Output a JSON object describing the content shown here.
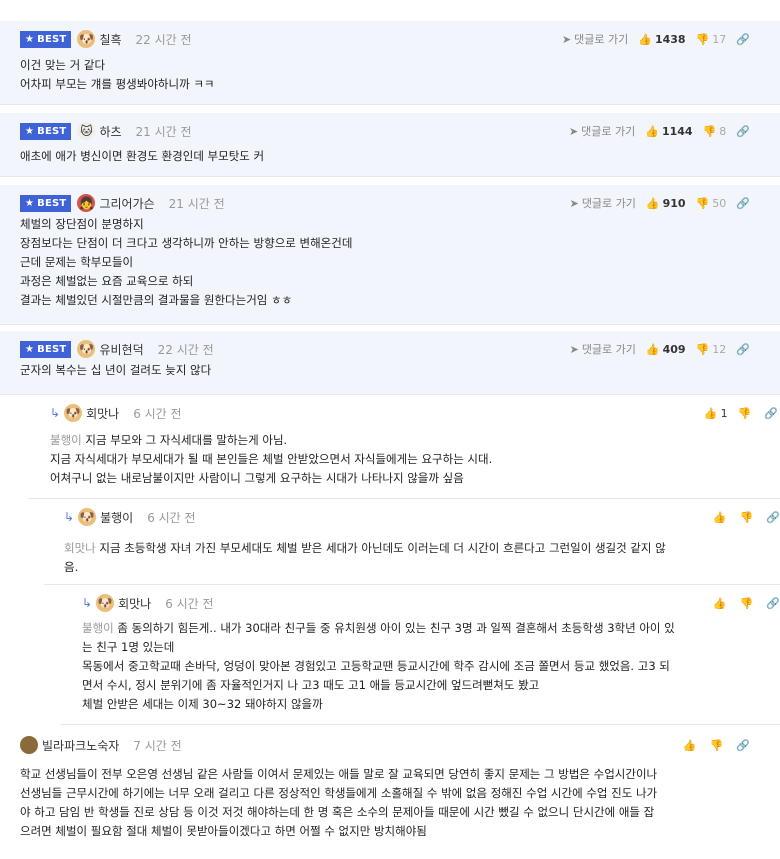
{
  "ui": {
    "best_label": "BEST",
    "goto_label": "댓글로 가기"
  },
  "comments": [
    {
      "best": true,
      "nick": "칠흑",
      "time": "22 시간 전",
      "up": "1438",
      "down": "17",
      "lines": [
        "이건 맞는 거 같다",
        "어차피 부모는 걔를 평생봐야하니까 ㅋㅋ"
      ]
    },
    {
      "best": true,
      "nick": "하츠",
      "time": "21 시간 전",
      "up": "1144",
      "down": "8",
      "lines": [
        "애초에 애가 병신이면 환경도 환경인데 부모탓도 커"
      ]
    },
    {
      "best": true,
      "nick": "그리어가슨",
      "time": "21 시간 전",
      "up": "910",
      "down": "50",
      "lines": [
        "체벌의 장단점이 분명하지",
        "장점보다는 단점이 더 크다고 생각하니까 안하는 방향으로 변해온건데",
        "근데 문제는 학부모들이",
        "과정은 체벌없는 요즘 교육으로 하되",
        "결과는 체벌있던 시절만큼의 결과물을 원한다는거임 ㅎㅎ"
      ]
    },
    {
      "best": true,
      "nick": "유비현덕",
      "time": "22 시간 전",
      "up": "409",
      "down": "12",
      "lines": [
        "군자의 복수는 십 년이 걸려도 늦지 않다"
      ]
    },
    {
      "best": false,
      "nick": "회맛나",
      "time": "6 시간 전",
      "up": "1",
      "down": "",
      "mention": "불행이",
      "lines": [
        "지금 부모와 그 자식세대를 말하는게 아님.",
        "지금 자식세대가 부모세대가 될 때 본인들은 체벌 안받았으면서 자식들에게는 요구하는 시대.",
        "어쳐구니 없는 내로남불이지만 사람이니 그렇게 요구하는 시대가 나타나지 않을까 싶음"
      ]
    },
    {
      "best": false,
      "nick": "불행이",
      "time": "6 시간 전",
      "up": "",
      "down": "",
      "mention": "회맛나",
      "lines": [
        "지금 초등학생 자녀 가진 부모세대도 체벌 받은 세대가 아닌데도 이러는데 더 시간이 흐른다고 그런일이 생길것 같지 않",
        "음."
      ]
    },
    {
      "best": false,
      "nick": "회맛나",
      "time": "6 시간 전",
      "up": "",
      "down": "",
      "mention": "불행이",
      "lines": [
        "좀 동의하기 힘든게.. 내가 30대라 친구들 중 유치원생 아이 있는 친구 3명 과 일찍 결혼해서 초등학생 3학년 아이 있",
        "는 친구 1명 있는데",
        "목동에서 중고학교때 손바닥, 엉덩이 맞아본 경험있고 고등학교땐 등교시간에 학주 감시에 조금 쫄면서 등교 했었음. 고3 되",
        "면서 수시, 정시 분위기에 좀 자율적인거지 나 고3 때도 고1 애들 등교시간에 엎드려뻗쳐도 봤고",
        "체벌 안받은 세대는 이제 30~32 돼야하지 않을까"
      ]
    },
    {
      "best": false,
      "nick": "빌라파크노숙자",
      "time": "7 시간 전",
      "up": "",
      "down": "",
      "lines": [
        "학교 선생님들이 전부 오은영 선생님 같은 사람들 이여서 문제있는 애들 말로 잘 교육되면 당연히 좋지 문제는 그 방법은 수업시간이나",
        "선생님들 근무시간에 하기에는 너무 오래 걸리고 다른 정상적인 학생들에게 소홀해질 수 밖에 없음 정해진 수업 시간에 수업 진도 나가",
        "야 하고 담임 반 학생들 진로 상담 등 이것 저것 해야하는데 한 명 혹은 소수의 문제아들 때문에 시간 뺐길 수 없으니 단시간에 애들 잡",
        "으려면 체벌이 필요함 절대 체벌이 못받아들이겠다고 하면 어쩔 수 없지만 방치해야됨"
      ]
    }
  ]
}
